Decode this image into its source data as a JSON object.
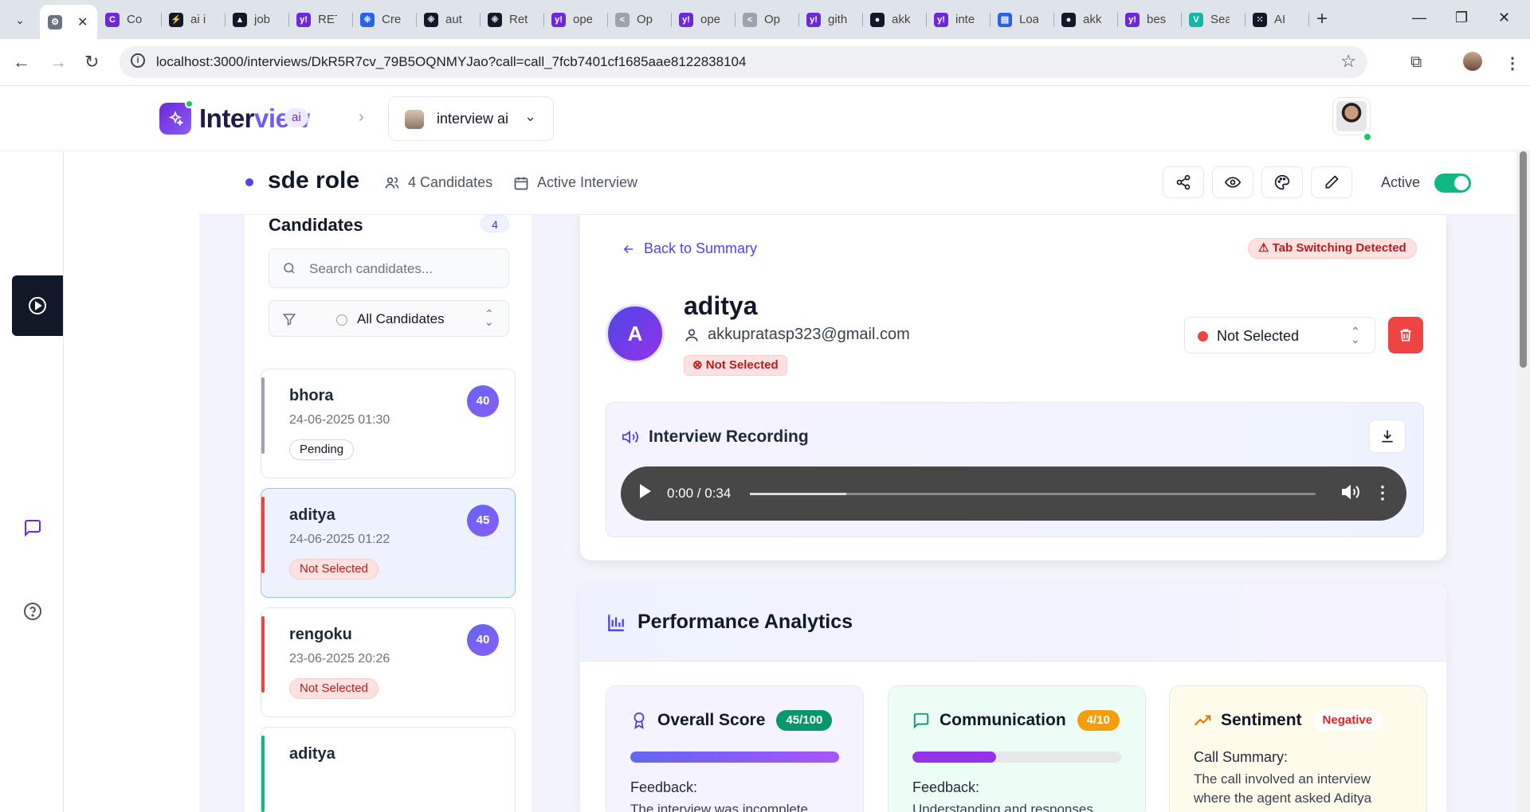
{
  "browser": {
    "tabs": [
      {
        "label": "",
        "color": "#6b7280",
        "glyph": "⚙"
      },
      {
        "label": "Co",
        "color": "#6d28d9",
        "glyph": "C"
      },
      {
        "label": "ai i",
        "color": "#111827",
        "glyph": "⚡"
      },
      {
        "label": "job",
        "color": "#111827",
        "glyph": "▲"
      },
      {
        "label": "RET",
        "color": "#6d28d9",
        "glyph": "y!"
      },
      {
        "label": "Cre",
        "color": "#2563eb",
        "glyph": "⁜"
      },
      {
        "label": "aut",
        "color": "#111827",
        "glyph": "⁜"
      },
      {
        "label": "Ret",
        "color": "#111827",
        "glyph": "⁜"
      },
      {
        "label": "ope",
        "color": "#6d28d9",
        "glyph": "y!"
      },
      {
        "label": "Op",
        "color": "#9ca3af",
        "glyph": "<"
      },
      {
        "label": "ope",
        "color": "#6d28d9",
        "glyph": "y!"
      },
      {
        "label": "Op",
        "color": "#9ca3af",
        "glyph": "<"
      },
      {
        "label": "gith",
        "color": "#6d28d9",
        "glyph": "y!"
      },
      {
        "label": "akk",
        "color": "#111827",
        "glyph": "●"
      },
      {
        "label": "inte",
        "color": "#6d28d9",
        "glyph": "y!"
      },
      {
        "label": "Loa",
        "color": "#2563eb",
        "glyph": "▤"
      },
      {
        "label": "akk",
        "color": "#111827",
        "glyph": "●"
      },
      {
        "label": "bes",
        "color": "#6d28d9",
        "glyph": "y!"
      },
      {
        "label": "Sea",
        "color": "#14b8a6",
        "glyph": "V"
      },
      {
        "label": "AI",
        "color": "#111827",
        "glyph": "⁙"
      }
    ],
    "url": "localhost:3000/interviews/DkR5R7cv_79B5OQNMYJao?call=call_7fcb7401cf1685aae8122838104"
  },
  "header": {
    "brand_part1": "Inter",
    "brand_part2": "view",
    "brand_badge": "ai",
    "org_name": "interview ai"
  },
  "interview": {
    "title": "sde role",
    "candidates_meta": "4 Candidates",
    "status_meta": "Active Interview",
    "active_label": "Active",
    "active": true
  },
  "candidates_panel": {
    "title": "Candidates",
    "count": "4",
    "search_placeholder": "Search candidates...",
    "filter_value": "All Candidates",
    "items": [
      {
        "name": "bhora",
        "date": "24-06-2025 01:30",
        "score": "40",
        "status": "Pending",
        "stripe": "#9ca3af",
        "selected": false
      },
      {
        "name": "aditya",
        "date": "24-06-2025 01:22",
        "score": "45",
        "status": "Not Selected",
        "stripe": "#ef4444",
        "selected": true
      },
      {
        "name": "rengoku",
        "date": "23-06-2025 20:26",
        "score": "40",
        "status": "Not Selected",
        "stripe": "#ef4444",
        "selected": false
      },
      {
        "name": "aditya",
        "date": "",
        "score": "",
        "status": "",
        "stripe": "#10b981",
        "selected": false
      }
    ]
  },
  "detail": {
    "back_label": "Back to Summary",
    "warning": "Tab Switching Detected",
    "avatar_letter": "A",
    "name": "aditya",
    "email": "akkupratasp323@gmail.com",
    "status_badge": "Not Selected",
    "status_select": "Not Selected",
    "recording_title": "Interview Recording",
    "audio_time": "0:00 / 0:34",
    "audio_progress": 0.17
  },
  "performance": {
    "title": "Performance Analytics",
    "metrics": [
      {
        "title": "Overall Score",
        "badge": "45/100",
        "badge_bg": "#059669",
        "badge_fg": "#ffffff",
        "progress": 1.0,
        "fill": "linear-gradient(90deg,#6366f1,#a855f7)",
        "bg": "#f5f3ff",
        "label": "Feedback:",
        "text": "The interview was incomplete..."
      },
      {
        "title": "Communication",
        "badge": "4/10",
        "badge_bg": "#f59e0b",
        "badge_fg": "#ffffff",
        "progress": 0.4,
        "fill": "#9333ea",
        "bg": "#ecfdf5",
        "label": "Feedback:",
        "text": "Understanding and responses..."
      },
      {
        "title": "Sentiment",
        "badge": "Negative",
        "badge_bg": "#ffffff",
        "badge_fg": "#dc2626",
        "progress": null,
        "fill": "",
        "bg": "#fffbeb",
        "label": "Call Summary:",
        "text": "The call involved an interview where the agent asked Aditya"
      }
    ]
  }
}
